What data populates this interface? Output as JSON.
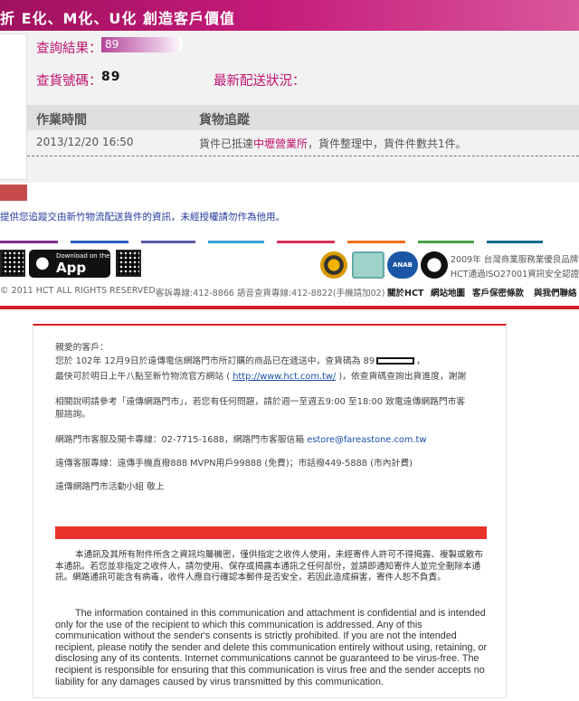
{
  "hct": {
    "header_slogan": "折 E化、M化、U化 創造客戶價值",
    "query_result_label": "查詢結果：",
    "query_result_value": "89",
    "tracking_no_label": "查貨號碼：",
    "tracking_no_value": "89",
    "latest_status_label": "最新配送狀況：",
    "table": {
      "col_time": "作業時間",
      "col_tracking": "貨物追蹤",
      "rows": [
        {
          "time": "2013/12/20 16:50",
          "status_prefix": "貨件已抵達",
          "status_hub": "中壢營業所",
          "status_suffix": "，貨件整理中，貨件件數共1件。"
        }
      ]
    },
    "notice": "提供您追蹤交由新竹物流配送貨件的資訊，未經授權請勿作為他用。",
    "app_store_small": "Download on the",
    "app_store_big": "App Store",
    "cert_line1": "2009年 台灣商業服務業優良品牌",
    "cert_line2": "HCT通過ISO27001資訊安全認證",
    "cert_badge_anab": "ANAB",
    "copyright": "© 2011 HCT ALL RIGHTS RESERVED.",
    "hotline": "客訴專線:412-8866 語音查貨專線:412-8822(手機請加02)",
    "footer_links": [
      "關於HCT",
      "網站地圖",
      "客戶保密條款",
      "與我們聯絡"
    ],
    "stripe_colors": [
      "#7f2d8a",
      "#2a5bbf",
      "#5a5aaa",
      "#3aa0d8",
      "#d8325f",
      "#f07020",
      "#4aa24a",
      "#0d6b8c"
    ]
  },
  "mail": {
    "greeting": "親愛的客戶：",
    "line1_a": "您於 102年 12月9日於遠傳電信網路門市所訂購的商品已在遞送中，查貨碼為 89",
    "line1_b": "，",
    "line2_a": "最快可於明日上午八點至新竹物流官方網站 ( ",
    "line2_link": "http://www.hct.com.tw/",
    "line2_b": " )，依查貨碼查詢出貨進度，謝謝",
    "line3": "相關說明請參考「遠傳網路門市」，若您有任何問題，請於週一至週五9:00 至18:00 致電遠傳網路門市客",
    "line4": "服諮詢。",
    "line5_a": "網路門市客服及開卡專線：02-7715-1688，網路門市客服信箱 ",
    "line5_mail": "estore@fareastone.com.tw",
    "line6": "遠傳客服專線：遠傳手機直撥888 MVPN用戶99888 (免費)；市話撥449-5888 (市內計費)",
    "signature": "遠傳網路門市活動小組 敬上",
    "disclaimer_zh": "本通訊及其所有附件所含之資訊均屬機密，僅供指定之收件人使用，未經寄件人許可不得揭露、複製或散布本通訊。若您並非指定之收件人，請勿使用、保存或揭露本通訊之任何部份，並請即通知寄件人並完全刪除本通訊。網路通訊可能含有病毒，收件人應自行確認本郵件是否安全，若因此造成損害，寄件人恕不負責。",
    "disclaimer_en": "The information contained in this communication and attachment is confidential and is intended only for the use of the recipient to which this communication is addressed. Any of this communication without the sender's consents is strictly prohibited. If you are not the intended recipient, please notify the sender and delete this communication entirely without using, retaining, or disclosing any of its contents. Internet communications cannot be guaranteed to be virus-free. The recipient is responsible for ensuring that this communication is virus free and the sender accepts no liability for any damages caused by virus transmitted by this communication."
  }
}
